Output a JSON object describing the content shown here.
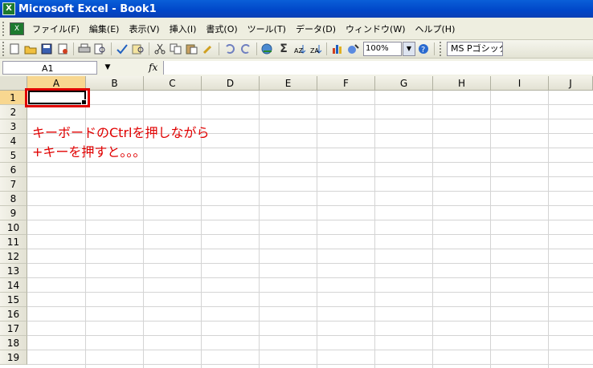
{
  "window": {
    "title": "Microsoft Excel - Book1",
    "app_icon": "X"
  },
  "menu": {
    "doc_icon": "X",
    "items": [
      "ファイル(F)",
      "編集(E)",
      "表示(V)",
      "挿入(I)",
      "書式(O)",
      "ツール(T)",
      "データ(D)",
      "ウィンドウ(W)",
      "ヘルプ(H)"
    ]
  },
  "toolbar": {
    "zoom": "100%",
    "font_name": "MS Pゴシック",
    "sum_symbol": "Σ",
    "icons": [
      "new-icon",
      "open-icon",
      "save-icon",
      "permission-icon",
      "print-icon",
      "print-preview-icon",
      "spelling-icon",
      "research-icon",
      "cut-icon",
      "copy-icon",
      "paste-icon",
      "format-painter-icon",
      "undo-icon",
      "redo-icon",
      "hyperlink-icon",
      "autosum-icon",
      "sort-ascending-icon",
      "sort-descending-icon",
      "chart-wizard-icon",
      "drawing-icon",
      "help-icon"
    ]
  },
  "formula_bar": {
    "name_box": "A1",
    "fx_label": "fx",
    "value": ""
  },
  "sheet": {
    "columns": [
      "A",
      "B",
      "C",
      "D",
      "E",
      "F",
      "G",
      "H",
      "I",
      "J"
    ],
    "rows": [
      "1",
      "2",
      "3",
      "4",
      "5",
      "6",
      "7",
      "8",
      "9",
      "10",
      "11",
      "12",
      "13",
      "14",
      "15",
      "16",
      "17",
      "18",
      "19"
    ],
    "active_cell": "A1"
  },
  "annotation": {
    "line1": "キーボードのCtrlを押しながら",
    "line2": "+キーを押すと。。。",
    "color": "#e00000"
  }
}
